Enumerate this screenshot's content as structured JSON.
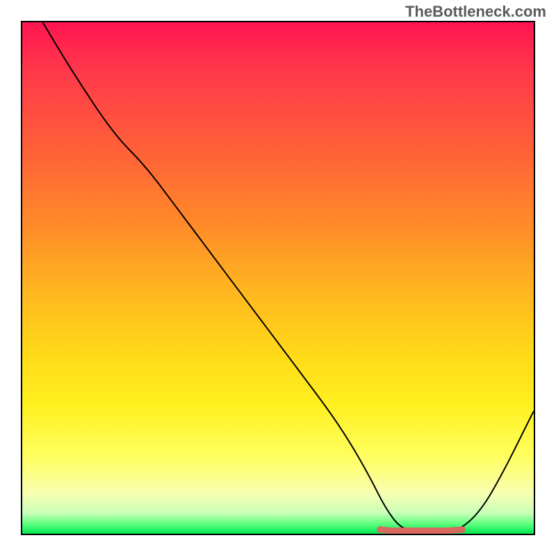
{
  "watermark": "TheBottleneck.com",
  "chart_data": {
    "type": "line",
    "title": "",
    "xlabel": "",
    "ylabel": "",
    "xlim": [
      0,
      100
    ],
    "ylim": [
      0,
      100
    ],
    "series": [
      {
        "name": "bottleneck-curve",
        "x": [
          4,
          10,
          18,
          24,
          30,
          36,
          42,
          48,
          54,
          60,
          64,
          68,
          71,
          74,
          78,
          82,
          86,
          90,
          94,
          98,
          100
        ],
        "y": [
          100,
          90,
          78,
          72,
          64,
          56,
          48,
          40,
          32,
          24,
          18,
          11,
          5,
          1,
          0.2,
          0.2,
          1,
          5,
          12,
          20,
          24
        ]
      }
    ],
    "markers": {
      "name": "optimal-zone",
      "color": "#d86860",
      "points": [
        {
          "x": 70,
          "y": 0.8
        },
        {
          "x": 72,
          "y": 0.6
        },
        {
          "x": 74,
          "y": 0.6
        },
        {
          "x": 76,
          "y": 0.6
        },
        {
          "x": 78,
          "y": 0.6
        },
        {
          "x": 80,
          "y": 0.6
        },
        {
          "x": 83,
          "y": 0.6
        },
        {
          "x": 86,
          "y": 0.8
        }
      ]
    },
    "gradient_stops": [
      {
        "pos": 0,
        "color": "#ff1450"
      },
      {
        "pos": 25,
        "color": "#ff6038"
      },
      {
        "pos": 52,
        "color": "#ffb420"
      },
      {
        "pos": 75,
        "color": "#fff020"
      },
      {
        "pos": 92,
        "color": "#f8ffb0"
      },
      {
        "pos": 100,
        "color": "#00e850"
      }
    ]
  }
}
